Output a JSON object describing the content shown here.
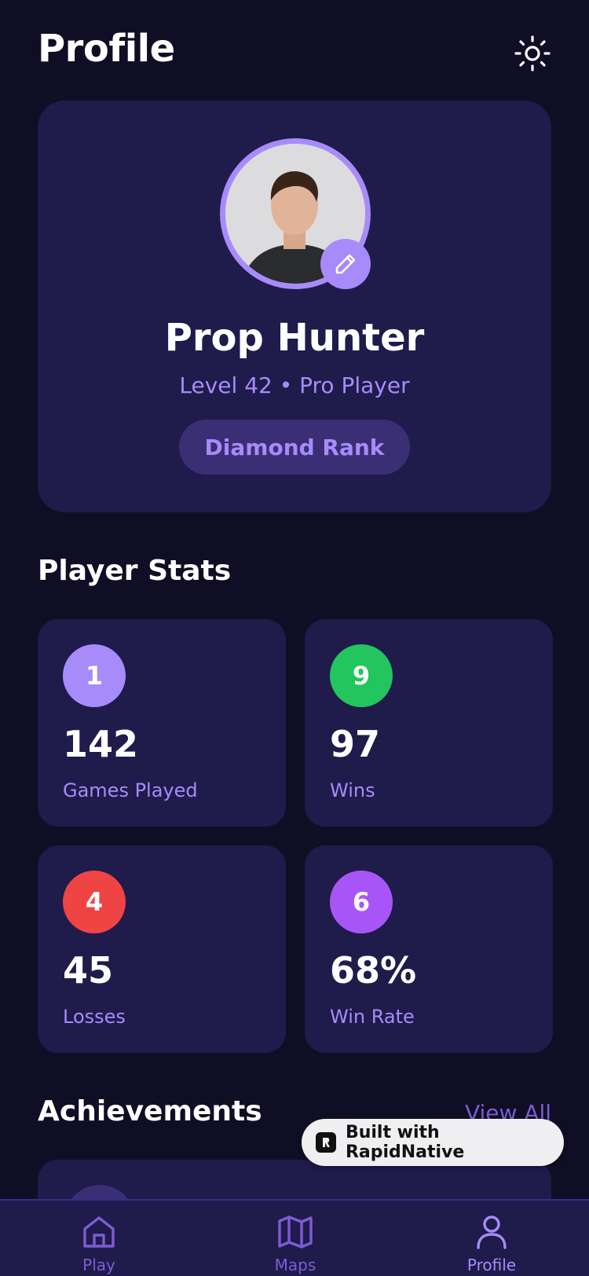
{
  "header": {
    "title": "Profile",
    "theme_icon": "sun-icon"
  },
  "profile": {
    "name": "Prop Hunter",
    "subtitle": "Level 42 • Pro Player",
    "rank": "Diamond Rank",
    "edit_icon": "pencil-icon",
    "accent": "#a78bfa"
  },
  "stats": {
    "title": "Player Stats",
    "items": [
      {
        "badge": "1",
        "value": "142",
        "label": "Games Played",
        "color": "#a78bfa"
      },
      {
        "badge": "9",
        "value": "97",
        "label": "Wins",
        "color": "#22c55e"
      },
      {
        "badge": "4",
        "value": "45",
        "label": "Losses",
        "color": "#ef4444"
      },
      {
        "badge": "6",
        "value": "68%",
        "label": "Win Rate",
        "color": "#a855f7"
      }
    ]
  },
  "achievements": {
    "title": "Achievements",
    "view_all": "View All"
  },
  "built_with": {
    "label": "Built with RapidNative"
  },
  "nav": {
    "items": [
      {
        "label": "Play",
        "icon": "home-icon",
        "active": false
      },
      {
        "label": "Maps",
        "icon": "map-icon",
        "active": false
      },
      {
        "label": "Profile",
        "icon": "user-icon",
        "active": true
      }
    ]
  }
}
